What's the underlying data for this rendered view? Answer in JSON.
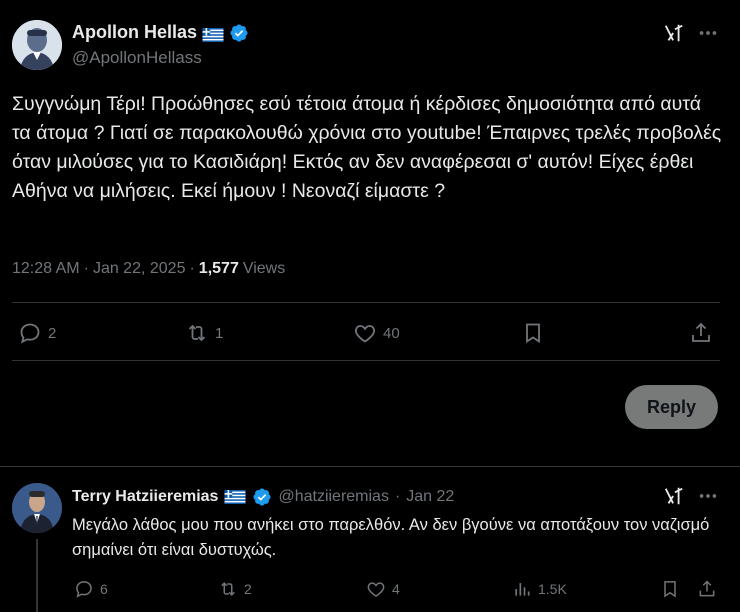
{
  "post": {
    "author_name": "Apollon Hellas",
    "author_handle": "@ApollonHellass",
    "text": "Συγγνώμη Τέρι! Προώθησες εσύ τέτοια άτομα ή κέρδισες δημοσιότητα από αυτά τα άτομα ? Γιατί σε παρακολουθώ χρόνια στο youtube! Έπαιρνες τρελές προβολές όταν μιλούσες για το Κασιδιάρη! Εκτός αν δεν αναφέρεσαι σ' αυτόν! Είχες έρθει Αθήνα να μιλήσεις. Εκεί ήμουν ! Νεοναζί είμαστε ?",
    "time": "12:28 AM",
    "separator": "·",
    "date": "Jan 22, 2025",
    "views_count": "1,577",
    "views_label": "Views",
    "replies": "2",
    "reposts": "1",
    "likes": "40"
  },
  "reply_button": {
    "label": "Reply"
  },
  "reply": {
    "author_name": "Terry Hatziieremias",
    "author_handle": "@hatziieremias",
    "separator": "·",
    "date": "Jan 22",
    "text": "Μεγάλο λάθος μου που ανήκει στο παρελθόν. Αν δεν βγούνε να αποτάξουν τον ναζισμό σημαίνει ότι είναι δυστυχώς.",
    "replies": "6",
    "reposts": "2",
    "likes": "4",
    "views": "1.5K"
  },
  "colors": {
    "background": "#000000",
    "text": "#e7e9ea",
    "muted": "#71767b",
    "verified": "#1d9bf0",
    "divider": "#2f3336"
  },
  "icons": [
    "verified-badge-icon",
    "greek-flag-icon",
    "grok-icon",
    "more-icon",
    "reply-icon",
    "repost-icon",
    "like-icon",
    "bookmark-icon",
    "share-icon",
    "views-icon"
  ]
}
